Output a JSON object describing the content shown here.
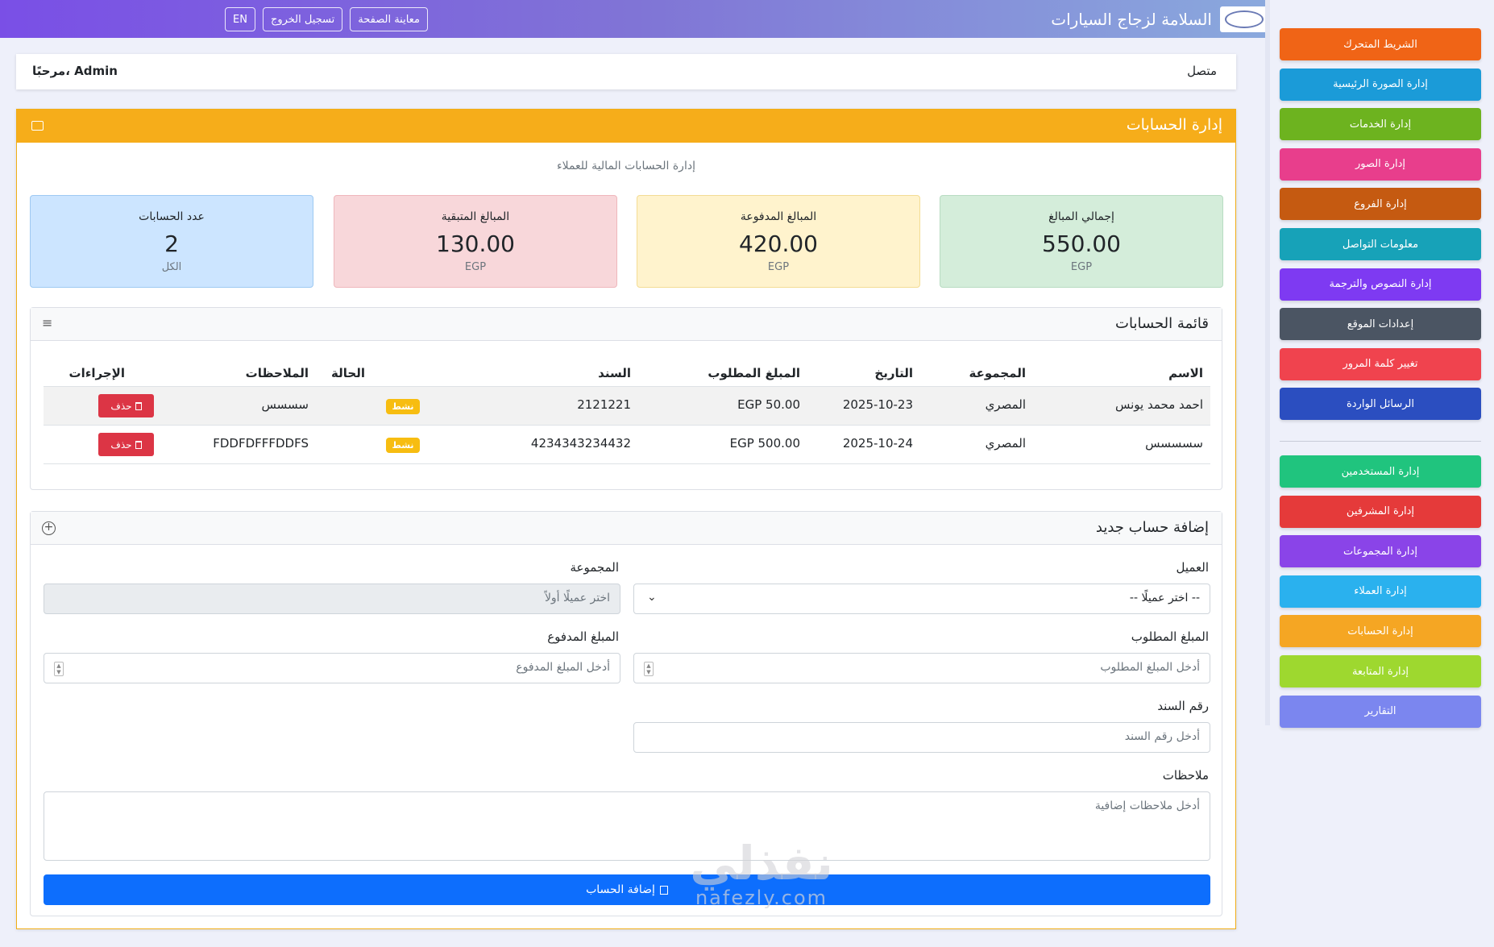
{
  "header": {
    "brand_title": "السلامة لزجاج السيارات",
    "buttons": [
      "معاينة الصفحة",
      "تسجيل الخروج",
      "EN"
    ]
  },
  "sidebar": {
    "group1": [
      {
        "label": "الشريط المتحرك",
        "color": "#f06416"
      },
      {
        "label": "إدارة الصورة الرئيسية",
        "color": "#1b9bd8"
      },
      {
        "label": "إدارة الخدمات",
        "color": "#6db31f"
      },
      {
        "label": "إدارة الصور",
        "color": "#e83e8c"
      },
      {
        "label": "إدارة الفروع",
        "color": "#c55a11"
      },
      {
        "label": "معلومات التواصل",
        "color": "#17a2b8"
      },
      {
        "label": "إدارة النصوص والترجمة",
        "color": "#7e3af2"
      },
      {
        "label": "إعدادات الموقع",
        "color": "#4b5563"
      },
      {
        "label": "تغيير كلمة المرور",
        "color": "#f0434e"
      },
      {
        "label": "الرسائل الواردة",
        "color": "#2b4ec0"
      }
    ],
    "group2": [
      {
        "label": "إدارة المستخدمين",
        "color": "#20c47e"
      },
      {
        "label": "إدارة المشرفين",
        "color": "#e53a3a"
      },
      {
        "label": "إدارة المجموعات",
        "color": "#8a44e8"
      },
      {
        "label": "إدارة العملاء",
        "color": "#2ab1ee"
      },
      {
        "label": "إدارة الحسابات",
        "color": "#f5a623"
      },
      {
        "label": "إدارة المتابعة",
        "color": "#9ed82f"
      },
      {
        "label": "التقارير",
        "color": "#7b86ef"
      }
    ]
  },
  "welcome": {
    "status": "متصل",
    "greeting": "مرحبًا، Admin"
  },
  "page": {
    "title": "إدارة الحسابات",
    "subtitle": "إدارة الحسابات المالية للعملاء"
  },
  "stats": [
    {
      "label": "إجمالي المبالغ",
      "value": "550.00",
      "unit": "EGP",
      "bg": "#d4edda",
      "border": "#b8dcc2"
    },
    {
      "label": "المبالغ المدفوعة",
      "value": "420.00",
      "unit": "EGP",
      "bg": "#fff3cd",
      "border": "#f3dc94"
    },
    {
      "label": "المبالغ المتبقية",
      "value": "130.00",
      "unit": "EGP",
      "bg": "#f8d7da",
      "border": "#efb7bc"
    },
    {
      "label": "عدد الحسابات",
      "value": "2",
      "unit": "الكل",
      "bg": "#cce5ff",
      "border": "#9ec9f2"
    }
  ],
  "accounts_list": {
    "title": "قائمة الحسابات",
    "columns": [
      "الاسم",
      "المجموعة",
      "التاريخ",
      "المبلغ المطلوب",
      "السند",
      "الحالة",
      "الملاحظات",
      "الإجراءات"
    ],
    "rows": [
      {
        "name": "احمد محمد يونس",
        "group": "المصري",
        "date": "2025-10-23",
        "amount": "EGP 50.00",
        "voucher": "2121221",
        "status": "نشط",
        "notes": "سسسس",
        "action": "حذف"
      },
      {
        "name": "سسسسس",
        "group": "المصري",
        "date": "2025-10-24",
        "amount": "EGP 500.00",
        "voucher": "4234343234432",
        "status": "نشط",
        "notes": "FDDFDFFFDDFS",
        "action": "حذف"
      }
    ]
  },
  "add_form": {
    "title": "إضافة حساب جديد",
    "client_label": "العميل",
    "client_value": "-- اختر عميلًا --",
    "group_label": "المجموعة",
    "group_placeholder": "اختر عميلًا أولاً",
    "required_label": "المبلغ المطلوب",
    "required_placeholder": "أدخل المبلغ المطلوب",
    "paid_label": "المبلغ المدفوع",
    "paid_placeholder": "أدخل المبلغ المدفوع",
    "voucher_label": "رقم السند",
    "voucher_placeholder": "أدخل رقم السند",
    "notes_label": "ملاحظات",
    "notes_placeholder": "أدخل ملاحظات إضافية",
    "submit_label": "إضافة الحساب"
  },
  "watermark": {
    "main": "نفذلي",
    "sub": "nafezly.com"
  }
}
